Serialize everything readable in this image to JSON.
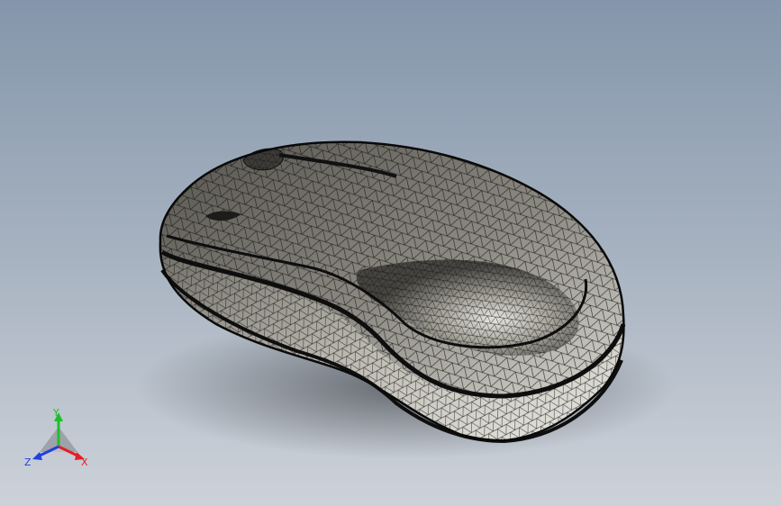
{
  "viewport": {
    "background_top": "#8496ab",
    "background_bottom": "#cdd2d9",
    "model": {
      "name": "computer-mouse-mesh",
      "display_mode": "wireframe-mesh",
      "surface_color": "#a8a69b",
      "edge_color": "#141414"
    }
  },
  "triad": {
    "x_label": "X",
    "y_label": "Y",
    "z_label": "Z",
    "x_color": "#e0202a",
    "y_color": "#1fbf2a",
    "z_color": "#2040e0"
  }
}
